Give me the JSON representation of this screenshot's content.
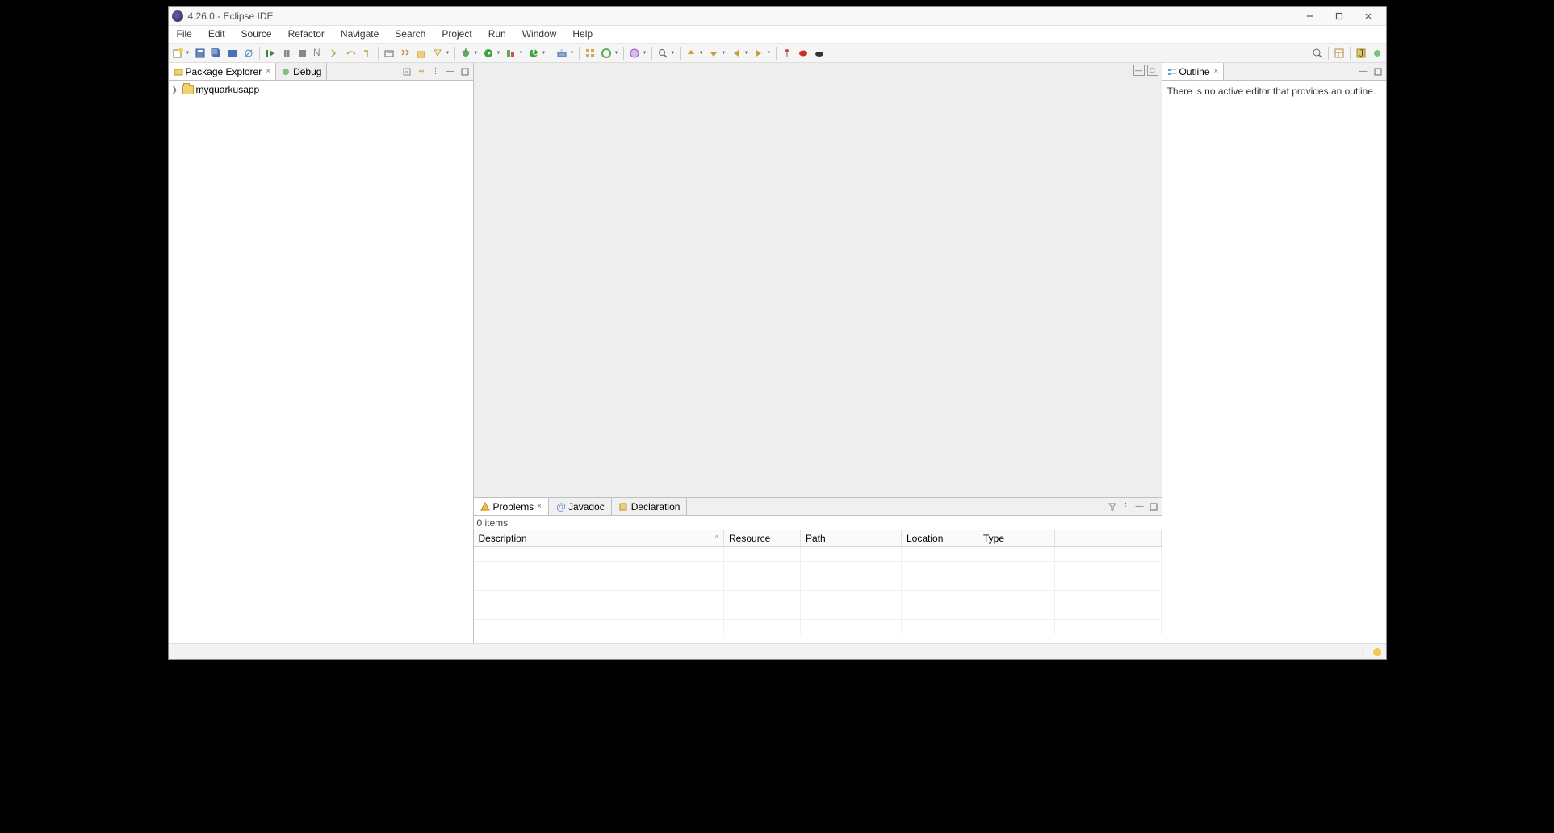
{
  "title": "4.26.0 - Eclipse IDE",
  "menus": [
    "File",
    "Edit",
    "Source",
    "Refactor",
    "Navigate",
    "Search",
    "Project",
    "Run",
    "Window",
    "Help"
  ],
  "left": {
    "tabs": [
      {
        "label": "Package Explorer",
        "active": true
      },
      {
        "label": "Debug",
        "active": false
      }
    ],
    "tree": [
      {
        "label": "myquarkusapp"
      }
    ]
  },
  "right": {
    "tab": "Outline",
    "message": "There is no active editor that provides an outline."
  },
  "bottom": {
    "tabs": [
      {
        "label": "Problems",
        "active": true
      },
      {
        "label": "Javadoc",
        "active": false
      },
      {
        "label": "Declaration",
        "active": false
      }
    ],
    "summary": "0 items",
    "columns": [
      "Description",
      "Resource",
      "Path",
      "Location",
      "Type"
    ]
  }
}
